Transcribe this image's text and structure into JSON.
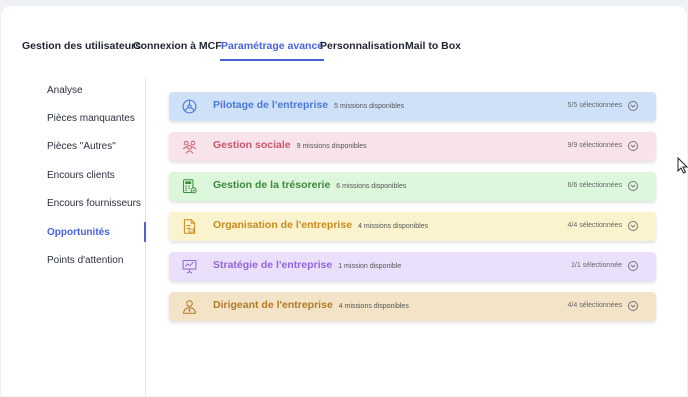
{
  "tabs": [
    {
      "label": "Gestion des utilisateurs",
      "active": false
    },
    {
      "label": "Connexion à MCF",
      "active": false
    },
    {
      "label": "Paramétrage avancé",
      "active": true
    },
    {
      "label": "Personnalisation",
      "active": false
    },
    {
      "label": "Mail to Box",
      "active": false
    }
  ],
  "sidebar": {
    "items": [
      {
        "label": "Analyse",
        "active": false
      },
      {
        "label": "Pièces manquantes",
        "active": false
      },
      {
        "label": "Pièces \"Autres\"",
        "active": false
      },
      {
        "label": "Encours clients",
        "active": false
      },
      {
        "label": "Encours fournisseurs",
        "active": false
      },
      {
        "label": "Opportunités",
        "active": true
      },
      {
        "label": "Points d'attention",
        "active": false
      }
    ]
  },
  "categories": [
    {
      "title": "Pilotage de l'entreprise",
      "count": "5 missions disponibles",
      "selected": "5/5 sélectionnées",
      "icon": "steering-wheel-icon",
      "bg": "#cfe0f9",
      "color": "#4a78d6"
    },
    {
      "title": "Gestion sociale",
      "count": "9 missions disponibles",
      "selected": "9/9 sélectionnées",
      "icon": "people-group-icon",
      "bg": "#f8e3ea",
      "color": "#c9566e"
    },
    {
      "title": "Gestion de la trésorerie",
      "count": "6 missions disponibles",
      "selected": "6/6 sélectionnées",
      "icon": "calculator-icon",
      "bg": "#dcf7dc",
      "color": "#3d8a3d"
    },
    {
      "title": "Organisation de l'entreprise",
      "count": "4 missions disponibles",
      "selected": "4/4 sélectionnées",
      "icon": "document-icon",
      "bg": "#fbf3cd",
      "color": "#c98b1f"
    },
    {
      "title": "Stratégie de l'entreprise",
      "count": "1 mission disponible",
      "selected": "1/1 sélectionnée",
      "icon": "presentation-board-icon",
      "bg": "#ebe0fb",
      "color": "#9166d6"
    },
    {
      "title": "Dirigeant de l'entreprise",
      "count": "4 missions disponibles",
      "selected": "4/4 sélectionnées",
      "icon": "person-badge-icon",
      "bg": "#f3e4c8",
      "color": "#b37a25"
    }
  ]
}
